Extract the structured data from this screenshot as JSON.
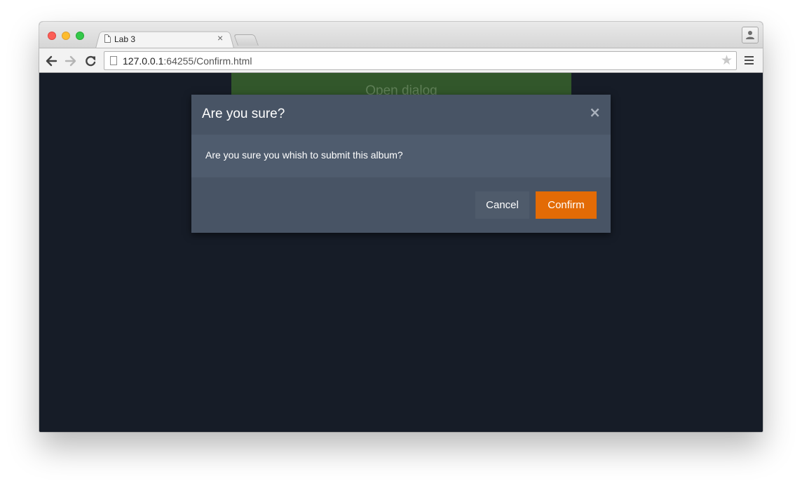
{
  "browser": {
    "tab_title": "Lab 3",
    "tab_close": "×",
    "url_host": "127.0.0.1",
    "url_rest": ":64255/Confirm.html",
    "star": "★"
  },
  "page": {
    "open_dialog_label": "Open dialog"
  },
  "dialog": {
    "title": "Are you sure?",
    "close": "×",
    "message": "Are you sure you whish to submit this album?",
    "cancel_label": "Cancel",
    "confirm_label": "Confirm"
  },
  "colors": {
    "page_background": "#161c27",
    "dialog_header": "#485465",
    "dialog_body": "#4f5c6e",
    "confirm_accent": "#e36b06",
    "open_dialog_button": "#32572b"
  }
}
